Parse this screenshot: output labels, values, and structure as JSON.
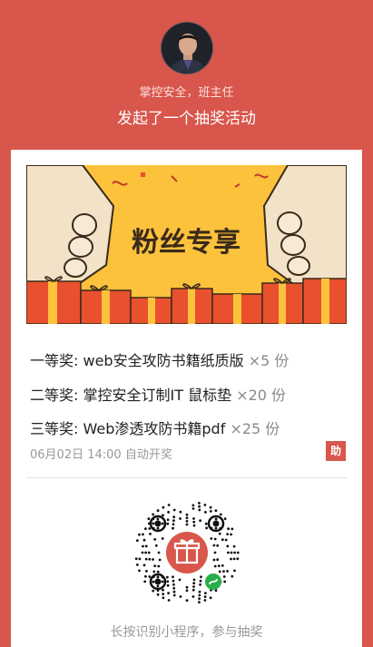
{
  "host": {
    "name": "掌控安全，班主任",
    "avatar_icon": "person-portrait-icon"
  },
  "headline": "发起了一个抽奖活动",
  "banner": {
    "title": "粉丝专享",
    "icons": [
      "gift-icon",
      "hand-icon"
    ]
  },
  "prizes": [
    {
      "rank": "一等奖:",
      "name": "web安全攻防书籍纸质版",
      "qty": "×5 份"
    },
    {
      "rank": "二等奖:",
      "name": "掌控安全订制IT 鼠标垫",
      "qty": "×20 份"
    },
    {
      "rank": "三等奖:",
      "name": "Web渗透攻防书籍pdf",
      "qty": "×25 份"
    }
  ],
  "draw_time": "06月02日 14:00 自动开奖",
  "helper_badge": "助",
  "qr": {
    "center_icon": "gift-icon",
    "mini_program_icon": "mini-program-icon"
  },
  "caption": "长按识别小程序，参与抽奖",
  "colors": {
    "accent": "#d8564b",
    "banner_bg": "#fcc23c",
    "gift_red": "#e8502e",
    "qr_green": "#2aae4a"
  }
}
